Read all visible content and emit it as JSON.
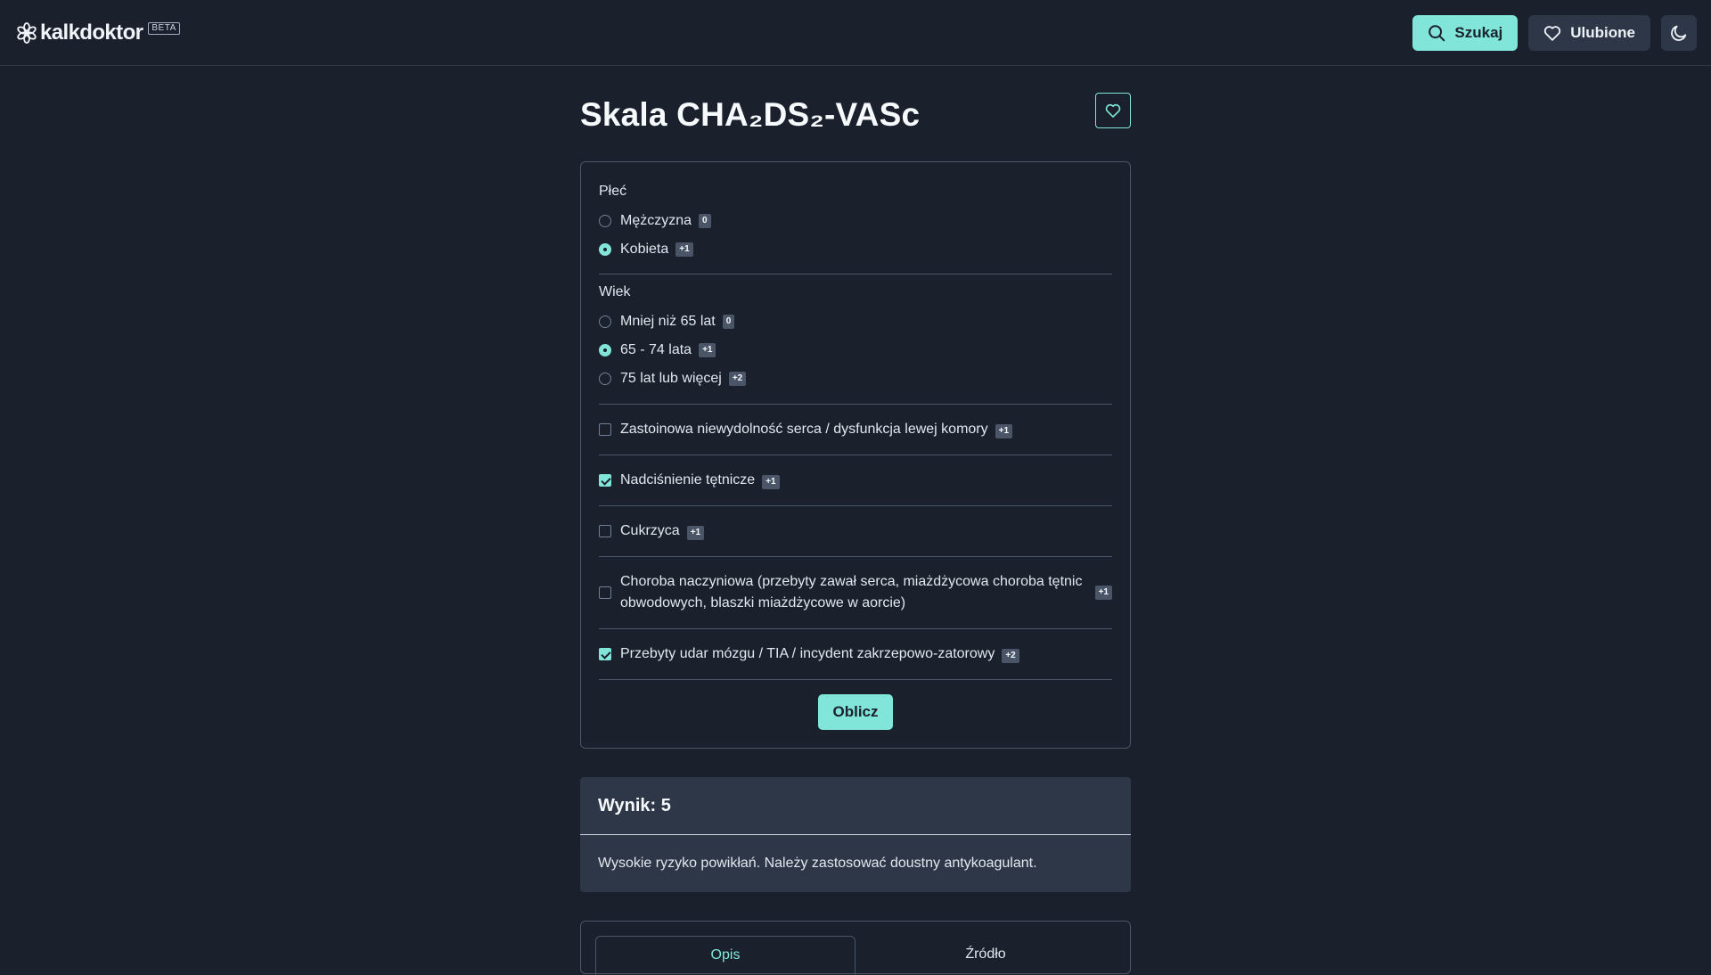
{
  "header": {
    "logo_text": "kalkdoktor",
    "beta_badge": "BETA",
    "search_label": "Szukaj",
    "favorites_label": "Ulubione",
    "icons": [
      "snowflake-logo-icon",
      "search-icon",
      "heart-icon",
      "moon-icon"
    ]
  },
  "page": {
    "title": "Skala CHA₂DS₂-VASc"
  },
  "form": {
    "sex": {
      "label": "Płeć",
      "options": [
        {
          "label": "Mężczyzna",
          "points": "0",
          "selected": false
        },
        {
          "label": "Kobieta",
          "points": "+1",
          "selected": true
        }
      ]
    },
    "age": {
      "label": "Wiek",
      "options": [
        {
          "label": "Mniej niż 65 lat",
          "points": "0",
          "selected": false
        },
        {
          "label": "65 - 74 lata",
          "points": "+1",
          "selected": true
        },
        {
          "label": "75 lat lub więcej",
          "points": "+2",
          "selected": false
        }
      ]
    },
    "criteria": [
      {
        "label": "Zastoinowa niewydolność serca / dysfunkcja lewej komory",
        "points": "+1",
        "checked": false
      },
      {
        "label": "Nadciśnienie tętnicze",
        "points": "+1",
        "checked": true
      },
      {
        "label": "Cukrzyca",
        "points": "+1",
        "checked": false
      },
      {
        "label": "Choroba naczyniowa (przebyty zawał serca, miażdżycowa choroba tętnic obwodowych, blaszki miażdżycowe w aorcie)",
        "points": "+1",
        "checked": false
      },
      {
        "label": "Przebyty udar mózgu / TIA / incydent zakrzepowo-zatorowy",
        "points": "+2",
        "checked": true
      }
    ],
    "submit_label": "Oblicz"
  },
  "result": {
    "heading": "Wynik: 5",
    "text": "Wysokie ryzyko powikłań. Należy zastosować doustny antykoagulant."
  },
  "tabs": [
    {
      "label": "Opis",
      "active": true
    },
    {
      "label": "Źródło",
      "active": false
    }
  ],
  "colors": {
    "background": "#1a202c",
    "accent": "#81e6d9",
    "surface": "#2d3748",
    "border": "#4a5568"
  }
}
